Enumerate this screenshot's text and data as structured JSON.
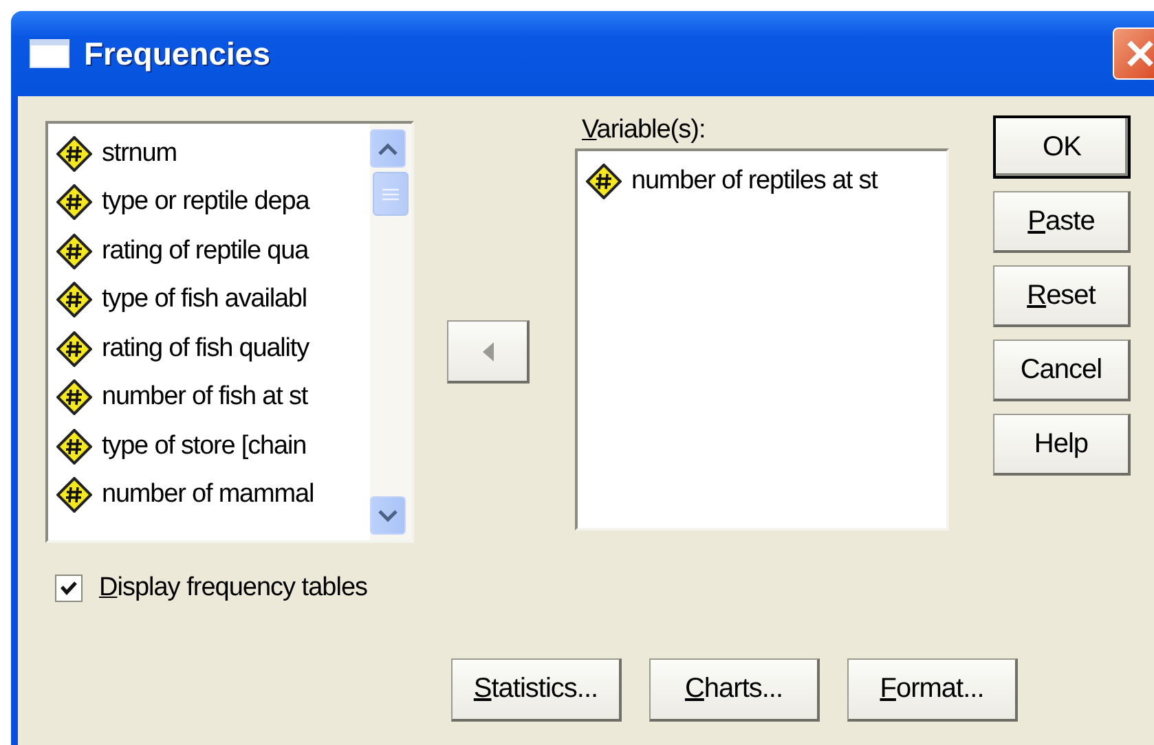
{
  "window": {
    "title": "Frequencies"
  },
  "source_list": {
    "items": [
      {
        "label": "strnum",
        "selected": false
      },
      {
        "label": "type or reptile depa",
        "selected": false
      },
      {
        "label": "rating of reptile qua",
        "selected": false
      },
      {
        "label": "type of fish availabl",
        "selected": false
      },
      {
        "label": "rating of fish quality",
        "selected": false
      },
      {
        "label": "number of fish at st",
        "selected": false
      },
      {
        "label": "type of store [chain",
        "selected": false
      },
      {
        "label": "number of mammal",
        "selected": false
      }
    ]
  },
  "target": {
    "label": "Variable(s):",
    "underline_first": true,
    "items": [
      {
        "label": "number of reptiles at st",
        "selected": false
      }
    ]
  },
  "side_buttons": [
    {
      "label": "OK",
      "underline_first": false,
      "default": true
    },
    {
      "label": "Paste",
      "underline_first": true,
      "default": false
    },
    {
      "label": "Reset",
      "underline_first": true,
      "default": false
    },
    {
      "label": "Cancel",
      "underline_first": false,
      "default": false
    },
    {
      "label": "Help",
      "underline_first": false,
      "default": false
    }
  ],
  "checkbox": {
    "label": "Display frequency tables",
    "underline_first": true,
    "checked": true
  },
  "bottom_buttons": [
    {
      "label": "Statistics...",
      "underline_first": true
    },
    {
      "label": "Charts...",
      "underline_first": true
    },
    {
      "label": "Format...",
      "underline_first": true
    }
  ]
}
